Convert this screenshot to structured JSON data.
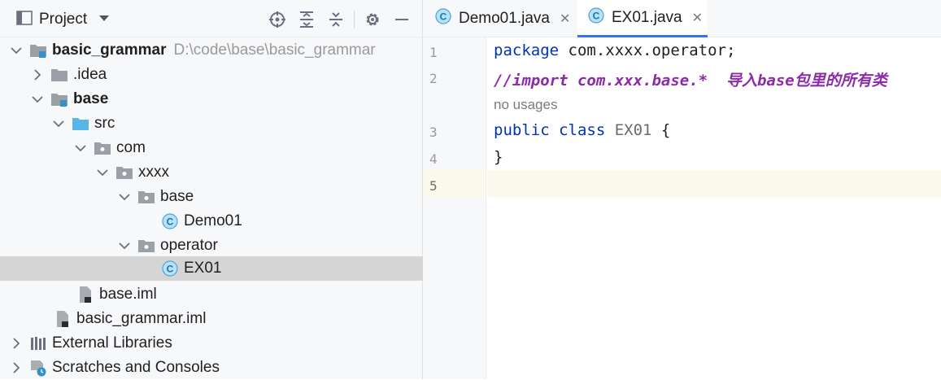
{
  "project_panel": {
    "title": "Project",
    "icons": [
      "locate-icon",
      "expand-all-icon",
      "collapse-all-icon",
      "settings-icon",
      "hide-icon"
    ]
  },
  "tree": [
    {
      "label": "basic_grammar",
      "path": "D:\\code\\base\\basic_grammar",
      "bold": true,
      "icon": "module-icon",
      "arrow": "down"
    },
    {
      "label": ".idea",
      "bold": false,
      "icon": "folder-icon",
      "arrow": "right"
    },
    {
      "label": "base",
      "bold": true,
      "icon": "module-icon",
      "arrow": "down"
    },
    {
      "label": "src",
      "bold": false,
      "icon": "source-folder-icon",
      "arrow": "down"
    },
    {
      "label": "com",
      "bold": false,
      "icon": "package-icon",
      "arrow": "down"
    },
    {
      "label": "xxxx",
      "bold": false,
      "icon": "package-icon",
      "arrow": "down"
    },
    {
      "label": "base",
      "bold": false,
      "icon": "package-icon",
      "arrow": "down"
    },
    {
      "label": "Demo01",
      "bold": false,
      "icon": "class-icon",
      "arrow": "none"
    },
    {
      "label": "operator",
      "bold": false,
      "icon": "package-icon",
      "arrow": "down"
    },
    {
      "label": "EX01",
      "bold": false,
      "icon": "class-icon",
      "arrow": "none",
      "selected": true
    },
    {
      "label": "base.iml",
      "bold": false,
      "icon": "iml-file-icon",
      "arrow": "none"
    },
    {
      "label": "basic_grammar.iml",
      "bold": false,
      "icon": "iml-file-icon",
      "arrow": "none"
    },
    {
      "label": "External Libraries",
      "bold": false,
      "icon": "libraries-icon",
      "arrow": "right"
    },
    {
      "label": "Scratches and Consoles",
      "bold": false,
      "icon": "scratches-icon",
      "arrow": "right"
    }
  ],
  "tabs": [
    {
      "label": "Demo01.java",
      "active": false
    },
    {
      "label": "EX01.java",
      "active": true
    }
  ],
  "editor": {
    "line_numbers": [
      "1",
      "2",
      "3",
      "4",
      "5"
    ],
    "line1": {
      "kw": "package",
      "rest": " com.xxxx.operator;"
    },
    "line2": {
      "comment": "//import com.xxx.base.*  导入base包里的所有类"
    },
    "usages": "no usages",
    "line3": {
      "kw": "public class",
      "name": " EX01 ",
      "brace": "{"
    },
    "line4": {
      "brace": "}"
    },
    "colors": {
      "keyword": "#0033b3",
      "comment": "#8c2ba9",
      "current_line": "#fcfaed",
      "selection": "#d5d5d5",
      "accent": "#3574f0"
    }
  }
}
